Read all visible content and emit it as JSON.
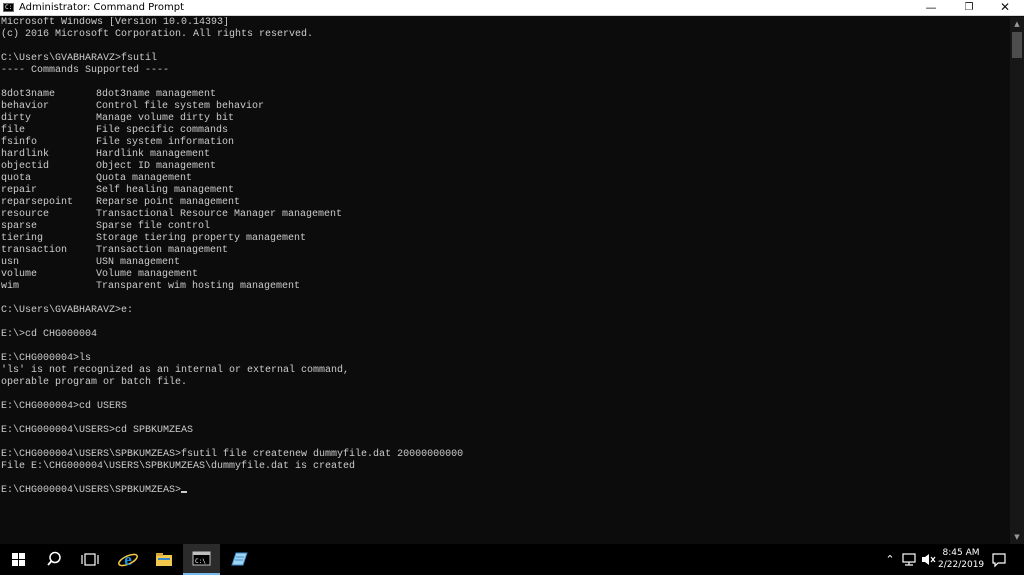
{
  "window": {
    "title": "Administrator: Command Prompt",
    "icon": "cmd-icon",
    "controls": {
      "minimize_icon": "minimize-icon",
      "maximize_icon": "restore-icon",
      "close_icon": "close-icon"
    }
  },
  "console": {
    "lines_before_list": [
      "Microsoft Windows [Version 10.0.14393]",
      "(c) 2016 Microsoft Corporation. All rights reserved.",
      "",
      "C:\\Users\\GVABHARAVZ>fsutil",
      "---- Commands Supported ----",
      ""
    ],
    "commands": [
      {
        "name": "8dot3name",
        "desc": "8dot3name management"
      },
      {
        "name": "behavior",
        "desc": "Control file system behavior"
      },
      {
        "name": "dirty",
        "desc": "Manage volume dirty bit"
      },
      {
        "name": "file",
        "desc": "File specific commands"
      },
      {
        "name": "fsinfo",
        "desc": "File system information"
      },
      {
        "name": "hardlink",
        "desc": "Hardlink management"
      },
      {
        "name": "objectid",
        "desc": "Object ID management"
      },
      {
        "name": "quota",
        "desc": "Quota management"
      },
      {
        "name": "repair",
        "desc": "Self healing management"
      },
      {
        "name": "reparsepoint",
        "desc": "Reparse point management"
      },
      {
        "name": "resource",
        "desc": "Transactional Resource Manager management"
      },
      {
        "name": "sparse",
        "desc": "Sparse file control"
      },
      {
        "name": "tiering",
        "desc": "Storage tiering property management"
      },
      {
        "name": "transaction",
        "desc": "Transaction management"
      },
      {
        "name": "usn",
        "desc": "USN management"
      },
      {
        "name": "volume",
        "desc": "Volume management"
      },
      {
        "name": "wim",
        "desc": "Transparent wim hosting management"
      }
    ],
    "lines_after_list": [
      "",
      "C:\\Users\\GVABHARAVZ>e:",
      "",
      "E:\\>cd CHG000004",
      "",
      "E:\\CHG000004>ls",
      "'ls' is not recognized as an internal or external command,",
      "operable program or batch file.",
      "",
      "E:\\CHG000004>cd USERS",
      "",
      "E:\\CHG000004\\USERS>cd SPBKUMZEAS",
      "",
      "E:\\CHG000004\\USERS\\SPBKUMZEAS>fsutil file createnew dummyfile.dat 20000000000",
      "File E:\\CHG000004\\USERS\\SPBKUMZEAS\\dummyfile.dat is created",
      ""
    ],
    "prompt": "E:\\CHG000004\\USERS\\SPBKUMZEAS>"
  },
  "taskbar": {
    "apps": [
      {
        "id": "start",
        "icon": "windows-start-icon"
      },
      {
        "id": "search",
        "icon": "search-icon"
      },
      {
        "id": "taskview",
        "icon": "task-view-icon"
      },
      {
        "id": "ie",
        "icon": "internet-explorer-icon"
      },
      {
        "id": "explorer",
        "icon": "file-explorer-icon"
      },
      {
        "id": "cmd",
        "icon": "command-prompt-icon",
        "active": true
      },
      {
        "id": "notes",
        "icon": "notepad-icon"
      }
    ],
    "tray": {
      "time": "8:45 AM",
      "date": "2/22/2019"
    }
  },
  "colors": {
    "console_background": "#0c0c0c",
    "console_text": "#cccccc",
    "taskbar_background": "#000000",
    "active_indicator": "#76b9ed",
    "ie_blue": "#1e90d6",
    "explorer_yellow": "#f2c94c"
  }
}
